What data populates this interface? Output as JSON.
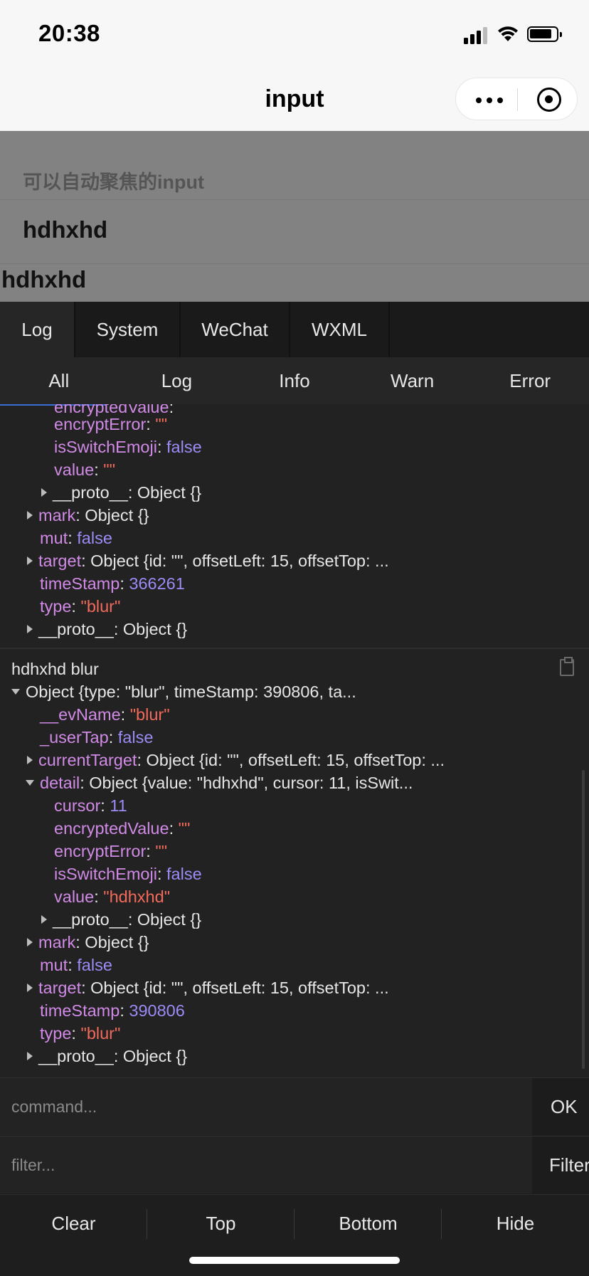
{
  "status_bar": {
    "time": "20:38"
  },
  "nav": {
    "title": "input"
  },
  "page": {
    "label": "可以自动聚焦的input",
    "input_value": "hdhxhd",
    "echo_text": "hdhxhd"
  },
  "console": {
    "tabs": [
      "Log",
      "System",
      "WeChat",
      "WXML"
    ],
    "subtabs": [
      "All",
      "Log",
      "Info",
      "Warn",
      "Error"
    ],
    "entry1": {
      "encryptedValue_key": "encryptedValue",
      "encryptError_key": "encryptError",
      "encryptError_val": "\"\"",
      "isSwitchEmoji_key": "isSwitchEmoji",
      "isSwitchEmoji_val": "false",
      "value_key": "value",
      "value_val": "\"\"",
      "proto_inner": "Object {}",
      "mark_val": "Object {}",
      "mut_val": "false",
      "target_val": "Object {id: \"\", offsetLeft: 15, offsetTop: ...",
      "timeStamp_val": "366261",
      "type_val": "\"blur\"",
      "proto_val": "Object {}"
    },
    "entry2": {
      "title": "hdhxhd blur",
      "summary": "Object {type: \"blur\", timeStamp: 390806, ta...",
      "evName_val": "\"blur\"",
      "userTap_val": "false",
      "currentTarget_val": "Object {id: \"\", offsetLeft: 15, offsetTop: ...",
      "detail_val": "Object {value: \"hdhxhd\", cursor: 11, isSwit...",
      "cursor_val": "11",
      "encryptedValue_val": "\"\"",
      "encryptError_val": "\"\"",
      "isSwitchEmoji_val": "false",
      "value_val": "\"hdhxhd\"",
      "proto_inner": "Object {}",
      "mark_val": "Object {}",
      "mut_val": "false",
      "target_val": "Object {id: \"\", offsetLeft: 15, offsetTop: ...",
      "timeStamp_val": "390806",
      "type_val": "\"blur\"",
      "proto_val": "Object {}"
    },
    "keys": {
      "proto": "__proto__",
      "mark": "mark",
      "mut": "mut",
      "target": "target",
      "timeStamp": "timeStamp",
      "type": "type",
      "evName": "__evName",
      "userTap": "_userTap",
      "currentTarget": "currentTarget",
      "detail": "detail",
      "cursor": "cursor",
      "encryptedValue": "encryptedValue",
      "encryptError": "encryptError",
      "isSwitchEmoji": "isSwitchEmoji",
      "value": "value"
    },
    "command_placeholder": "command...",
    "command_button": "OK",
    "filter_placeholder": "filter...",
    "filter_button": "Filter",
    "toolbar": [
      "Clear",
      "Top",
      "Bottom",
      "Hide"
    ]
  },
  "colors": {
    "key": "#d18ae6",
    "string": "#f26a5b",
    "number": "#9b8cf5",
    "active_blue": "#3b6fd6"
  }
}
